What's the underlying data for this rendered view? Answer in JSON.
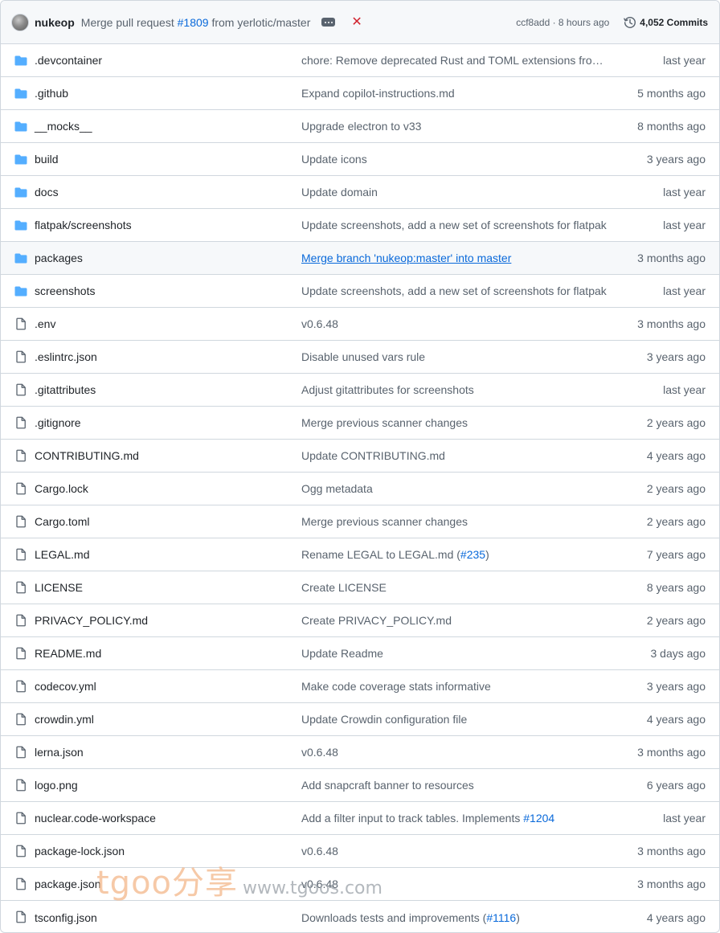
{
  "header": {
    "author": "nukeop",
    "message_prefix": "Merge pull request",
    "pr_link": "#1809",
    "message_suffix": "from yerlotic/master",
    "hash_time": "ccf8add · 8 hours ago",
    "commits_label": "4,052 Commits",
    "status_icon": "x-icon",
    "status_color": "#d1242f"
  },
  "colors": {
    "folder": "#54aeff",
    "link": "#0969da",
    "muted": "#59636e",
    "border": "#d0d7de"
  },
  "rows": [
    {
      "type": "dir",
      "name": ".devcontainer",
      "message": "chore: Remove deprecated Rust and TOML extensions from …",
      "pr": "",
      "after": "",
      "age": "last year"
    },
    {
      "type": "dir",
      "name": ".github",
      "message": "Expand copilot-instructions.md",
      "pr": "",
      "after": "",
      "age": "5 months ago"
    },
    {
      "type": "dir",
      "name": "__mocks__",
      "message": "Upgrade electron to v33",
      "pr": "",
      "after": "",
      "age": "8 months ago"
    },
    {
      "type": "dir",
      "name": "build",
      "message": "Update icons",
      "pr": "",
      "after": "",
      "age": "3 years ago"
    },
    {
      "type": "dir",
      "name": "docs",
      "message": "Update domain",
      "pr": "",
      "after": "",
      "age": "last year"
    },
    {
      "type": "dir",
      "name": "flatpak/screenshots",
      "message": "Update screenshots, add a new set of screenshots for flatpak",
      "pr": "",
      "after": "",
      "age": "last year"
    },
    {
      "type": "dir",
      "name": "packages",
      "message": "Merge branch 'nukeop:master' into master",
      "pr": "",
      "after": "",
      "age": "3 months ago",
      "highlight": true
    },
    {
      "type": "dir",
      "name": "screenshots",
      "message": "Update screenshots, add a new set of screenshots for flatpak",
      "pr": "",
      "after": "",
      "age": "last year"
    },
    {
      "type": "file",
      "name": ".env",
      "message": "v0.6.48",
      "pr": "",
      "after": "",
      "age": "3 months ago"
    },
    {
      "type": "file",
      "name": ".eslintrc.json",
      "message": "Disable unused vars rule",
      "pr": "",
      "after": "",
      "age": "3 years ago"
    },
    {
      "type": "file",
      "name": ".gitattributes",
      "message": "Adjust gitattributes for screenshots",
      "pr": "",
      "after": "",
      "age": "last year"
    },
    {
      "type": "file",
      "name": ".gitignore",
      "message": "Merge previous scanner changes",
      "pr": "",
      "after": "",
      "age": "2 years ago"
    },
    {
      "type": "file",
      "name": "CONTRIBUTING.md",
      "message": "Update CONTRIBUTING.md",
      "pr": "",
      "after": "",
      "age": "4 years ago"
    },
    {
      "type": "file",
      "name": "Cargo.lock",
      "message": "Ogg metadata",
      "pr": "",
      "after": "",
      "age": "2 years ago"
    },
    {
      "type": "file",
      "name": "Cargo.toml",
      "message": "Merge previous scanner changes",
      "pr": "",
      "after": "",
      "age": "2 years ago"
    },
    {
      "type": "file",
      "name": "LEGAL.md",
      "message": "Rename LEGAL to LEGAL.md (",
      "pr": "#235",
      "after": ")",
      "age": "7 years ago"
    },
    {
      "type": "file",
      "name": "LICENSE",
      "message": "Create LICENSE",
      "pr": "",
      "after": "",
      "age": "8 years ago"
    },
    {
      "type": "file",
      "name": "PRIVACY_POLICY.md",
      "message": "Create PRIVACY_POLICY.md",
      "pr": "",
      "after": "",
      "age": "2 years ago"
    },
    {
      "type": "file",
      "name": "README.md",
      "message": "Update Readme",
      "pr": "",
      "after": "",
      "age": "3 days ago"
    },
    {
      "type": "file",
      "name": "codecov.yml",
      "message": "Make code coverage stats informative",
      "pr": "",
      "after": "",
      "age": "3 years ago"
    },
    {
      "type": "file",
      "name": "crowdin.yml",
      "message": "Update Crowdin configuration file",
      "pr": "",
      "after": "",
      "age": "4 years ago"
    },
    {
      "type": "file",
      "name": "lerna.json",
      "message": "v0.6.48",
      "pr": "",
      "after": "",
      "age": "3 months ago"
    },
    {
      "type": "file",
      "name": "logo.png",
      "message": "Add snapcraft banner to resources",
      "pr": "",
      "after": "",
      "age": "6 years ago"
    },
    {
      "type": "file",
      "name": "nuclear.code-workspace",
      "message": "Add a filter input to track tables. Implements ",
      "pr": "#1204",
      "after": "",
      "age": "last year"
    },
    {
      "type": "file",
      "name": "package-lock.json",
      "message": "v0.6.48",
      "pr": "",
      "after": "",
      "age": "3 months ago"
    },
    {
      "type": "file",
      "name": "package.json",
      "message": "v0.6.48",
      "pr": "",
      "after": "",
      "age": "3 months ago"
    },
    {
      "type": "file",
      "name": "tsconfig.json",
      "message": "Downloads tests and improvements (",
      "pr": "#1116",
      "after": ")",
      "age": "4 years ago"
    }
  ],
  "watermark": {
    "logo": "tgoo分享",
    "site": "www.tgoos.com"
  }
}
